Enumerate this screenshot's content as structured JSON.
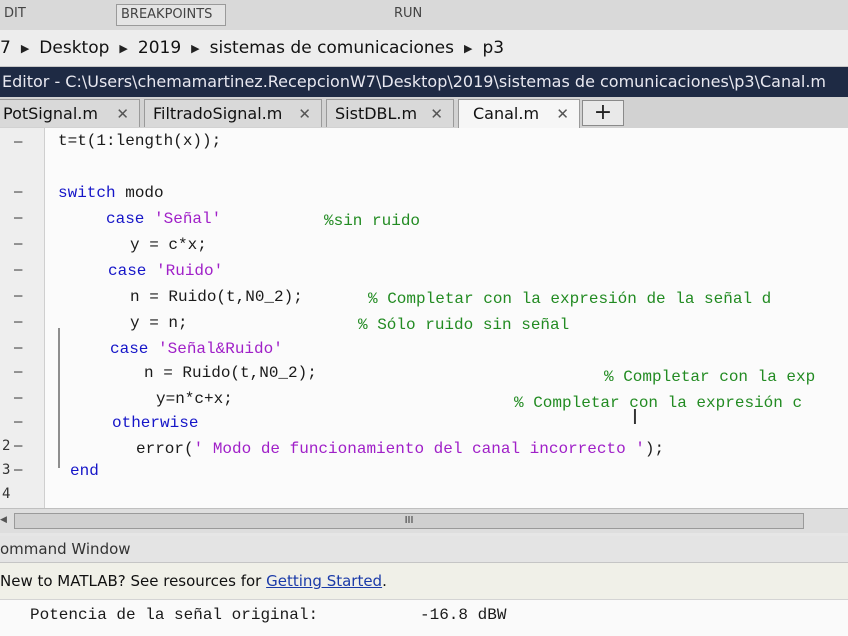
{
  "ribbon": {
    "tab_edit": "DIT",
    "tab_breakpoints": "BREAKPOINTS",
    "tab_run": "RUN"
  },
  "address": {
    "segments": [
      "7",
      "Desktop",
      "2019",
      "sistemas de comunicaciones",
      "p3"
    ]
  },
  "editor_title": "Editor - C:\\Users\\chemamartinez.RecepcionW7\\Desktop\\2019\\sistemas de comunicaciones\\p3\\Canal.m",
  "tabs": [
    {
      "label": "PotSignal.m"
    },
    {
      "label": "FiltradoSignal.m"
    },
    {
      "label": "SistDBL.m"
    },
    {
      "label": "Canal.m",
      "active": true
    }
  ],
  "add_tab_symbol": "+",
  "close_symbol": "✕",
  "gutter": {
    "dash": "–",
    "n2": "2",
    "n3": "3",
    "n4": "4"
  },
  "code": {
    "l1": "t=t(1:length(x));",
    "l2_kw": "switch",
    "l2_rest": " modo",
    "l3_kw": "case",
    "l3_str": "'Señal'",
    "l3_cm": "%sin ruido",
    "l4": "y = c*x;",
    "l5_kw": "case",
    "l5_str": "'Ruido'",
    "l6_code": "n = Ruido(t,N0_2);",
    "l6_cm": "% Completar con la expresión de la señal d",
    "l7_code": "y = n;",
    "l7_cm": "% Sólo ruido sin señal",
    "l8_kw": "case",
    "l8_str": "'Señal&Ruido'",
    "l9_code": "n = Ruido(t,N0_2);",
    "l9_cm": "% Completar con la exp",
    "l10_code": "y=n*c+x;",
    "l10_cm": "% Completar con la expresión c",
    "l11_kw": "otherwise",
    "l12_pre": "error(",
    "l12_str": "' Modo de funcionamiento del canal incorrecto '",
    "l12_post": ");",
    "l13_kw": "end"
  },
  "scrollbar_grip": "III",
  "command_window": {
    "title": "ommand Window",
    "tip_prefix": "New to MATLAB? See resources for ",
    "tip_link": "Getting Started",
    "tip_suffix": ".",
    "line1_label": "Potencia de la señal original:",
    "line1_value": "-16.8 dBW"
  }
}
